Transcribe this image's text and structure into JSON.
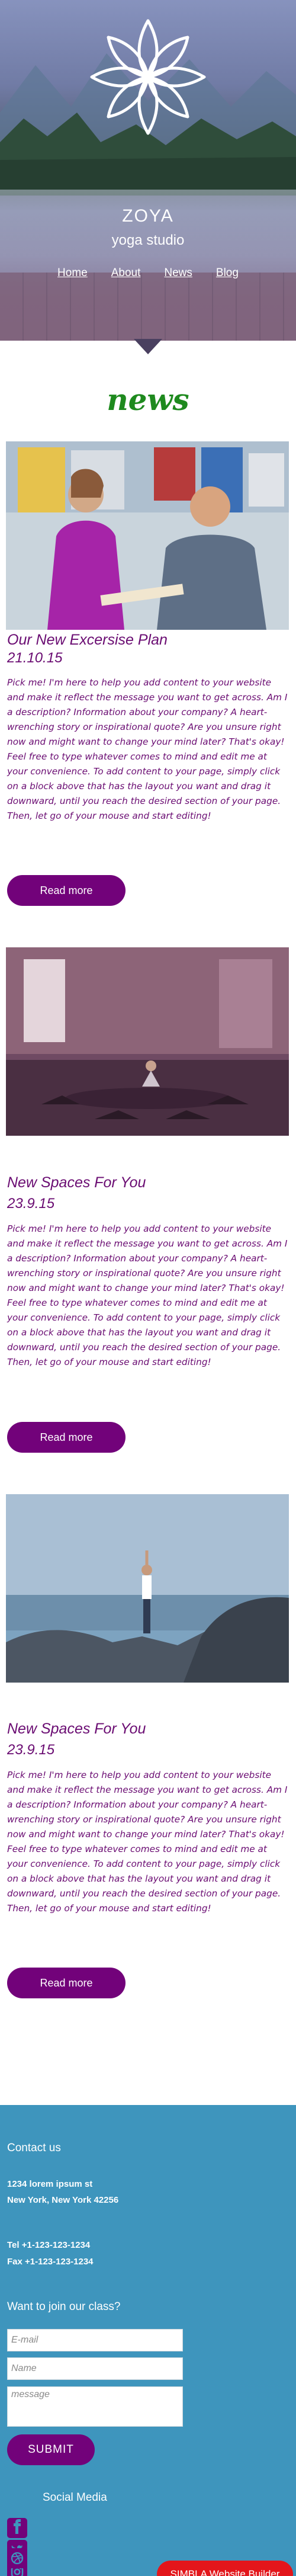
{
  "hero": {
    "brand_name": "ZOYA",
    "brand_tagline": "yoga studio",
    "nav": [
      {
        "label": "Home"
      },
      {
        "label": "About"
      },
      {
        "label": "News"
      },
      {
        "label": "Blog"
      }
    ]
  },
  "news": {
    "heading": "news",
    "posts": [
      {
        "title": "Our New Excersise Plan",
        "date": "21.10.15",
        "body": "Pick me! I'm here to help you add content to your website and make it reflect the message you want to get across. Am I a description? Information about your company? A heart-wrenching story or inspirational quote? Are you unsure right now and might want to change your mind later? That's okay! Feel free to type whatever comes to mind and edit me at your convenience. To add content to your page, simply click on a block above that has the layout you want and drag it downward, until you reach the desired section of your page. Then, let go of your mouse and start editing!",
        "button": "Read more",
        "image": "trainer-and-client-photo"
      },
      {
        "title": "New Spaces For You",
        "date": "23.9.15",
        "body": "Pick me! I'm here to help you add content to your website and make it reflect the message you want to get across. Am I a description? Information about your company? A heart-wrenching story or inspirational quote? Are you unsure right now and might want to change your mind later? That's okay! Feel free to type whatever comes to mind and edit me at your convenience. To add content to your page, simply click on a block above that has the layout you want and drag it downward, until you reach the desired section of your page. Then, let go of your mouse and start editing!",
        "button": "Read more",
        "image": "yoga-studio-room-photo"
      },
      {
        "title": "New Spaces For You",
        "date": "23.9.15",
        "body": "Pick me! I'm here to help you add content to your website and make it reflect the message you want to get across. Am I a description? Information about your company? A heart-wrenching story or inspirational quote? Are you unsure right now and might want to change your mind later? That's okay! Feel free to type whatever comes to mind and edit me at your convenience. To add content to your page, simply click on a block above that has the layout you want and drag it downward, until you reach the desired section of your page. Then, let go of your mouse and start editing!",
        "button": "Read more",
        "image": "tree-pose-on-rocks-photo"
      }
    ]
  },
  "footer": {
    "contact_heading": "Contact us",
    "address_line1": "1234 lorem ipsum st",
    "address_line2": "New York, New York 42256",
    "tel": "Tel +1-123-123-1234",
    "fax": "Fax +1-123-123-1234",
    "join_heading": "Want to join our class?",
    "email_placeholder": "E-mail",
    "name_placeholder": "Name",
    "message_placeholder": "message",
    "submit_label": "SUBMIT",
    "social_heading": "Social Media",
    "social_icons": [
      "facebook-icon",
      "twitter-icon",
      "instagram-icon",
      "dribbble-icon"
    ]
  },
  "badge": {
    "label": "SIMBLA Website Builder"
  },
  "colors": {
    "accent": "#72027a",
    "text": "#6a0c72",
    "news_heading": "#1e8a1e",
    "footer_bg": "#3e95bd",
    "badge_bg": "#e3161b"
  }
}
